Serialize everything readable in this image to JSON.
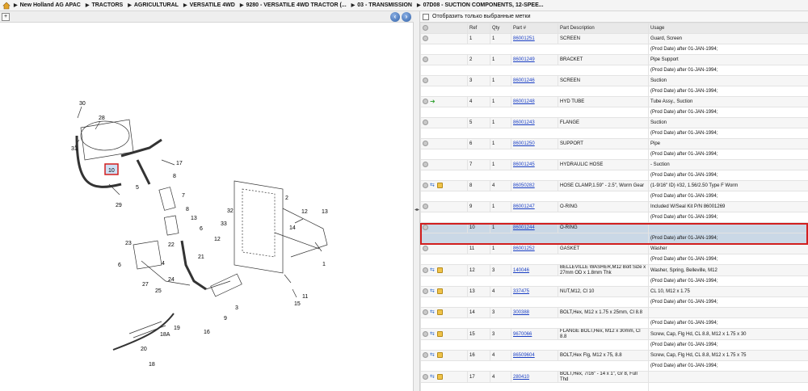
{
  "breadcrumb": [
    "New Holland AG APAC",
    "TRACTORS",
    "AGRICULTURAL",
    "VERSATILE 4WD",
    "9280 - VERSATILE 4WD TRACTOR (...",
    "03 - TRANSMISSION",
    "07D08 - SUCTION COMPONENTS, 12-SPEE..."
  ],
  "toolbar": {
    "prev_label": "‹",
    "next_label": "›",
    "zoom_label": "+"
  },
  "filter": {
    "label": "Отобразить только выбранные метки"
  },
  "table": {
    "headers": [
      "",
      "Ref",
      "Qty",
      "Part #",
      "Part Description",
      "Usage"
    ],
    "rows": [
      {
        "ref": "1",
        "qty": "1",
        "part": "86001251",
        "desc": "SCREEN",
        "usage": "Guard, Screen",
        "sub": "(Prod Date) after 01-JAN-1994;"
      },
      {
        "ref": "2",
        "qty": "1",
        "part": "86001249",
        "desc": "BRACKET",
        "usage": "Pipe Support",
        "sub": "(Prod Date) after 01-JAN-1994;"
      },
      {
        "ref": "3",
        "qty": "1",
        "part": "86001246",
        "desc": "SCREEN",
        "usage": "Suction",
        "sub": "(Prod Date) after 01-JAN-1994;"
      },
      {
        "ref": "4",
        "qty": "1",
        "part": "86001248",
        "desc": "HYD TUBE",
        "usage": "Tube Assy., Suction",
        "sub": "(Prod Date) after 01-JAN-1994;"
      },
      {
        "ref": "5",
        "qty": "1",
        "part": "86001243",
        "desc": "FLANGE",
        "usage": "Suction",
        "sub": "(Prod Date) after 01-JAN-1994;"
      },
      {
        "ref": "6",
        "qty": "1",
        "part": "86001250",
        "desc": "SUPPORT",
        "usage": "Pipe",
        "sub": "(Prod Date) after 01-JAN-1994;"
      },
      {
        "ref": "7",
        "qty": "1",
        "part": "86001245",
        "desc": "HYDRAULIC HOSE",
        "usage": "- Suction",
        "sub": "(Prod Date) after 01-JAN-1994;"
      },
      {
        "ref": "8",
        "qty": "4",
        "part": "86050282",
        "desc": "HOSE CLAMP,1.59\" - 2.5\", Worm Gear",
        "usage": "(1-9/16\" ID) #32, 1.56/2.50 Type F Worm",
        "sub": "(Prod Date) after 01-JAN-1994;"
      },
      {
        "ref": "9",
        "qty": "1",
        "part": "86001247",
        "desc": "O-RING",
        "usage": "Included W/Seal Kit P/N 86001269",
        "sub": "(Prod Date) after 01-JAN-1994;"
      },
      {
        "ref": "10",
        "qty": "1",
        "part": "86001244",
        "desc": "O-RING",
        "usage": "",
        "sub": "(Prod Date) after 01-JAN-1994;"
      },
      {
        "ref": "11",
        "qty": "1",
        "part": "86001252",
        "desc": "GASKET",
        "usage": "Washer",
        "sub": "(Prod Date) after 01-JAN-1994;"
      },
      {
        "ref": "12",
        "qty": "3",
        "part": "140046",
        "desc": "BELLEVILLE WASHER,M12 Bolt Size x 27mm OD x 1.8mm Thk",
        "usage": "Washer, Spring, Belleville, M12",
        "sub": "(Prod Date) after 01-JAN-1994;"
      },
      {
        "ref": "13",
        "qty": "4",
        "part": "337475",
        "desc": "NUT,M12, Cl 10",
        "usage": "CL 10, M12 x 1.75",
        "sub": "(Prod Date) after 01-JAN-1994;"
      },
      {
        "ref": "14",
        "qty": "3",
        "part": "300388",
        "desc": "BOLT,Hex, M12 x 1.75 x 25mm, Cl 8.8",
        "usage": "",
        "sub": "(Prod Date) after 01-JAN-1994;"
      },
      {
        "ref": "15",
        "qty": "3",
        "part": "9670066",
        "desc": "FLANGE BOLT,Hex, M12 x 30mm, Cl 8.8",
        "usage": "Screw, Cap, Flg Hd, CL 8.8, M12 x 1.75 x 30",
        "sub": "(Prod Date) after 01-JAN-1994;"
      },
      {
        "ref": "16",
        "qty": "4",
        "part": "86509604",
        "desc": "BOLT,Hex Flg, M12 x 75, 8.8",
        "usage": "Screw, Cap, Flg Hd, CL 8.8, M12 x 1.75 x 75",
        "sub": "(Prod Date) after 01-JAN-1994;"
      },
      {
        "ref": "17",
        "qty": "4",
        "part": "280410",
        "desc": "BOLT,Hex, 7/16\" - 14 x 1\", Gr 8, Full Thd",
        "usage": "",
        "sub": ""
      }
    ]
  },
  "diagram_labels": [
    "30",
    "28",
    "31",
    "10",
    "17",
    "8",
    "5",
    "29",
    "7",
    "8",
    "13",
    "6",
    "4",
    "32",
    "33",
    "2",
    "12",
    "13",
    "14",
    "1",
    "23",
    "22",
    "21",
    "12",
    "6",
    "27",
    "24",
    "25",
    "9",
    "3",
    "11",
    "15",
    "19",
    "18A",
    "16",
    "20",
    "18"
  ]
}
